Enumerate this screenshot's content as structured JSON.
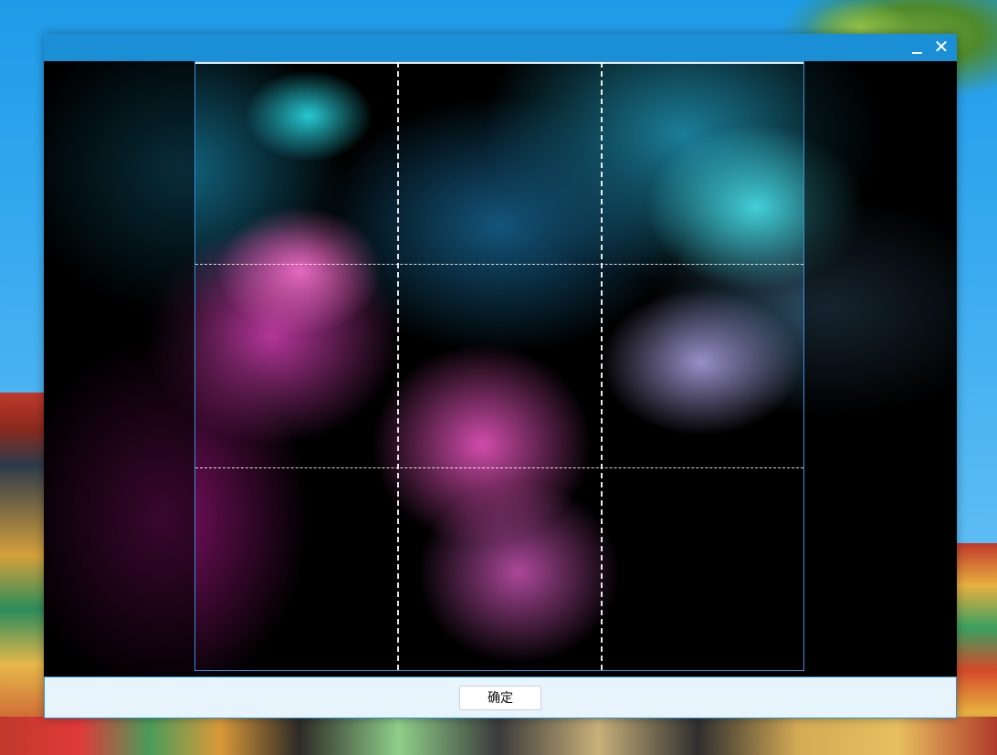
{
  "window": {
    "close_glyph": "✕"
  },
  "footer": {
    "confirm_label": "确定"
  },
  "icons": {
    "minimize": "minimize-icon",
    "close": "close-icon"
  },
  "colors": {
    "titlebar": "#1a8fd6",
    "footer_bg": "#e8f4fc",
    "crop_border": "#3b8fd8"
  }
}
